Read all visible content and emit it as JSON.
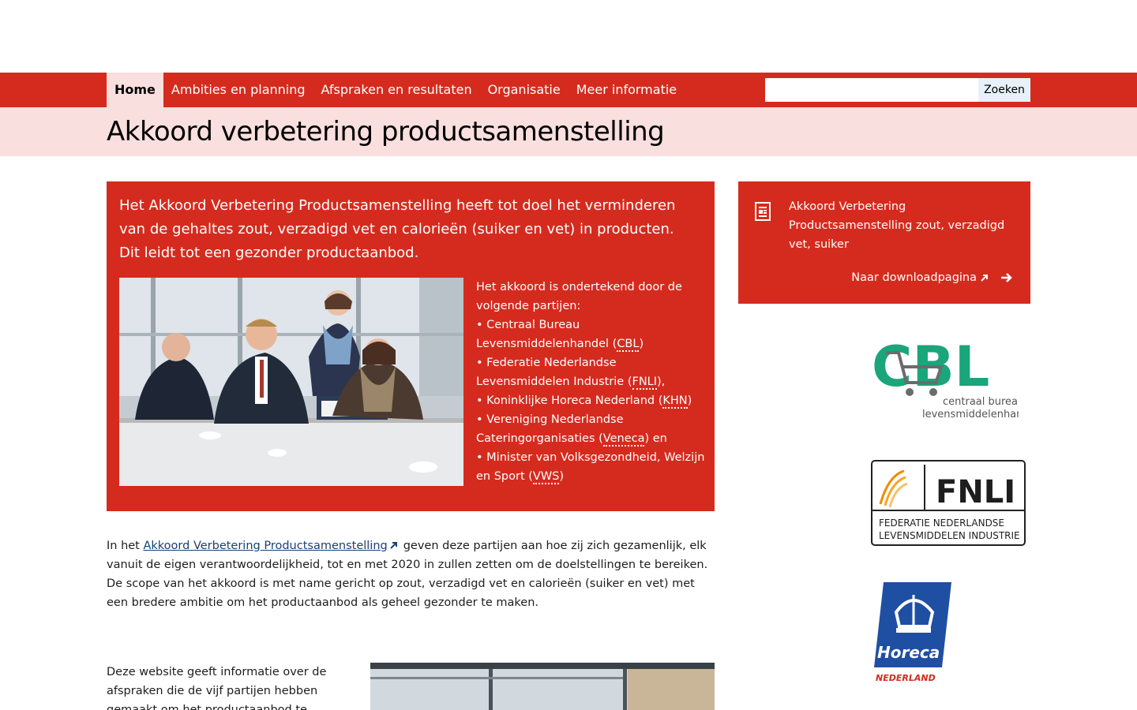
{
  "nav": {
    "items": [
      {
        "label": "Home",
        "active": true
      },
      {
        "label": "Ambities en planning",
        "active": false
      },
      {
        "label": "Afspraken en resultaten",
        "active": false
      },
      {
        "label": "Organisatie",
        "active": false
      },
      {
        "label": "Meer informatie",
        "active": false
      }
    ],
    "search": {
      "placeholder": "",
      "value": "",
      "button_label": "Zoeken"
    }
  },
  "page": {
    "title": "Akkoord verbetering productsamenstelling"
  },
  "intro": {
    "lead": "Het Akkoord Verbetering Productsamenstelling heeft tot doel het verminderen van de gehaltes zout, verzadigd vet en calorieën (suiker en vet) in producten. Dit leidt tot een gezonder productaanbod.",
    "partners": {
      "heading": "Het akkoord is ondertekend door de volgende partijen:",
      "items": [
        {
          "prefix": "• Centraal Bureau Levensmiddelenhandel (",
          "abbr": "CBL",
          "suffix": ")"
        },
        {
          "prefix": "• Federatie Nederlandse Levensmiddelen Industrie (",
          "abbr": "FNLI",
          "suffix": "),"
        },
        {
          "prefix": "• Koninklijke Horeca Nederland (",
          "abbr": "KHN",
          "suffix": ")"
        },
        {
          "prefix": "• Vereniging Nederlandse Cateringorganisaties (",
          "abbr": "Veneca",
          "suffix": ") en"
        },
        {
          "prefix": "• Minister van Volksgezondheid, Welzijn en Sport (",
          "abbr": "VWS",
          "suffix": ")"
        }
      ]
    }
  },
  "body": {
    "p1_before": "In het ",
    "p1_link": "Akkoord Verbetering Productsamenstelling",
    "p1_after": "geven deze partijen aan hoe zij zich gezamenlijk, elk vanuit de eigen verantwoordelijkheid, tot en met 2020 in zullen zetten om de doelstellingen te bereiken.",
    "p2": "De scope van het akkoord is met name gericht op zout, verzadigd vet en calorieën (suiker en vet) met een bredere ambitie om het productaanbod als geheel gezonder te maken.",
    "p3": "Deze website geeft informatie over de afspraken die de vijf partijen hebben gemaakt om het productaanbod te verbeteren en de voortgang"
  },
  "sidebar": {
    "download": {
      "title": "Akkoord Verbetering Productsamenstelling zout, verzadigd vet, suiker",
      "link_label": "Naar downloadpagina"
    },
    "logos": {
      "cbl": {
        "mark": "CBL",
        "line1": "centraal bureau",
        "line2": "levensmiddelenhandel"
      },
      "fnli": {
        "mark": "FNLI",
        "line1": "FEDERATIE NEDERLANDSE",
        "line2": "LEVENSMIDDELEN INDUSTRIE"
      },
      "khn": {
        "mark": "Horeca",
        "line1": "NEDERLAND"
      }
    }
  },
  "colors": {
    "brand_red": "#d52b1e",
    "pink_band": "#f9dfdd",
    "link_blue": "#154273",
    "cbl_green": "#1aa57a",
    "khn_blue": "#1f4fa3"
  }
}
